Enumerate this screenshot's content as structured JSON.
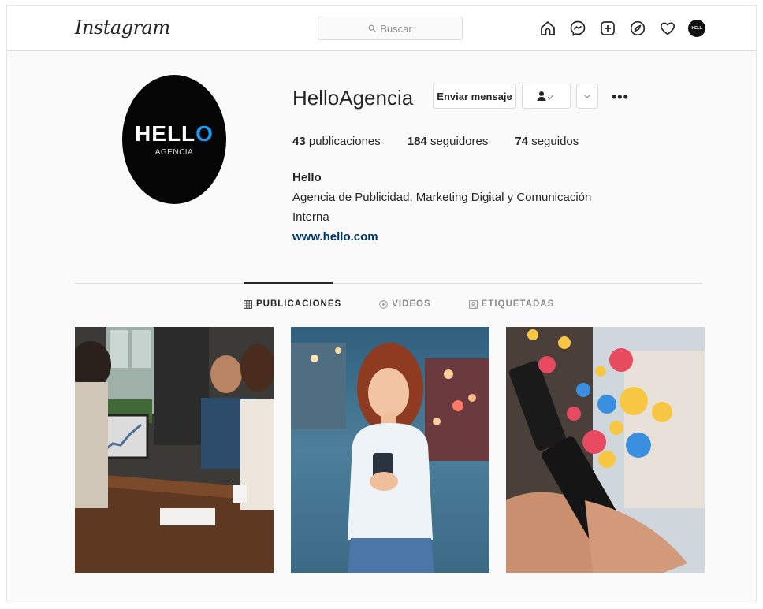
{
  "nav": {
    "logo": "Instagram",
    "search_placeholder": "Buscar",
    "icons": [
      "home-icon",
      "messenger-icon",
      "new-post-icon",
      "explore-icon",
      "activity-heart-icon",
      "profile-avatar"
    ]
  },
  "profile": {
    "username": "HelloAgencia",
    "avatar_brand": "HELL",
    "avatar_brand_accent": "O",
    "avatar_sub": "AGENCIA",
    "buttons": {
      "message": "Enviar mensaje"
    },
    "stats": [
      {
        "value": "43",
        "label": "publicaciones"
      },
      {
        "value": "184",
        "label": "seguidores"
      },
      {
        "value": "74",
        "label": "seguidos"
      }
    ],
    "bio": {
      "name": "Hello",
      "line1": "Agencia de Publicidad, Marketing Digital y Comunicación",
      "line2": "Interna",
      "link": "www.hello.com"
    }
  },
  "tabs": [
    {
      "label": "PUBLICACIONES",
      "active": true
    },
    {
      "label": "VIDEOS",
      "active": false
    },
    {
      "label": "ETIQUETADAS",
      "active": false
    }
  ],
  "posts": [
    {
      "subject": "team meeting at wooden table with laptop chart"
    },
    {
      "subject": "smiling woman using smartphone outdoors"
    },
    {
      "subject": "hands holding phones with floating emoji reactions"
    }
  ],
  "colors": {
    "link": "#00376b",
    "accent_blue": "#1d9bf0",
    "border": "#dbdbdb"
  }
}
